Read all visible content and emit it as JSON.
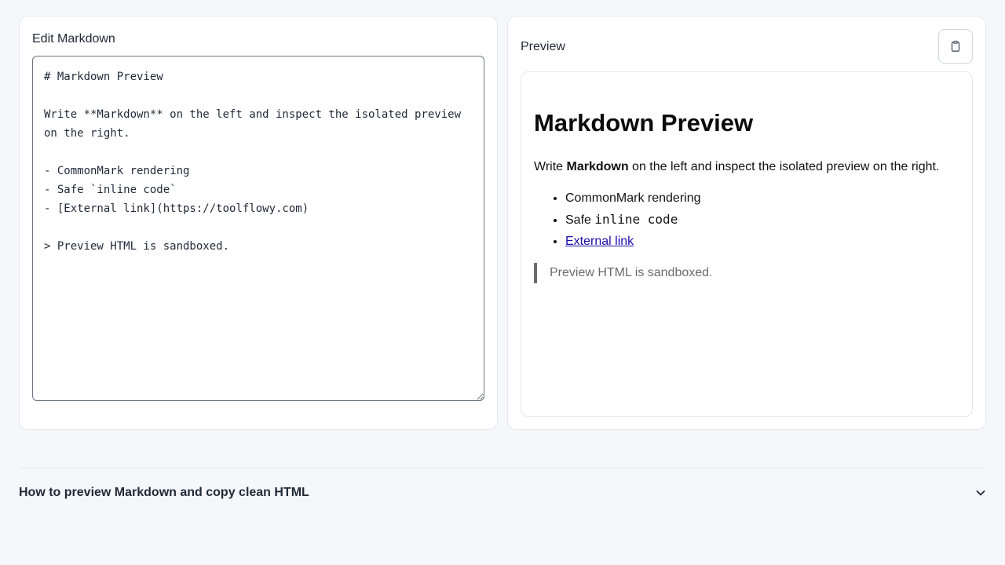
{
  "editor": {
    "title": "Edit Markdown",
    "content": "# Markdown Preview\n\nWrite **Markdown** on the left and inspect the isolated preview on the right.\n\n- CommonMark rendering\n- Safe `inline code`\n- [External link](https://toolflowy.com)\n\n> Preview HTML is sandboxed."
  },
  "preview": {
    "title": "Preview",
    "copy_icon": "clipboard-icon",
    "heading": "Markdown Preview",
    "paragraph_before": "Write ",
    "paragraph_bold": "Markdown",
    "paragraph_after": " on the left and inspect the isolated preview on the right.",
    "list": {
      "item1": "CommonMark rendering",
      "item2_text": "Safe ",
      "item2_code": "inline code",
      "item3_link": "External link"
    },
    "blockquote": "Preview HTML is sandboxed."
  },
  "faq": {
    "title": "How to preview Markdown and copy clean HTML",
    "icon": "chevron-down-icon"
  },
  "colors": {
    "background": "#f6f7fa",
    "panel": "#ffffff",
    "border": "#e5e7eb",
    "link": "#1a0dab",
    "blockquote": "#6b6b6b"
  }
}
